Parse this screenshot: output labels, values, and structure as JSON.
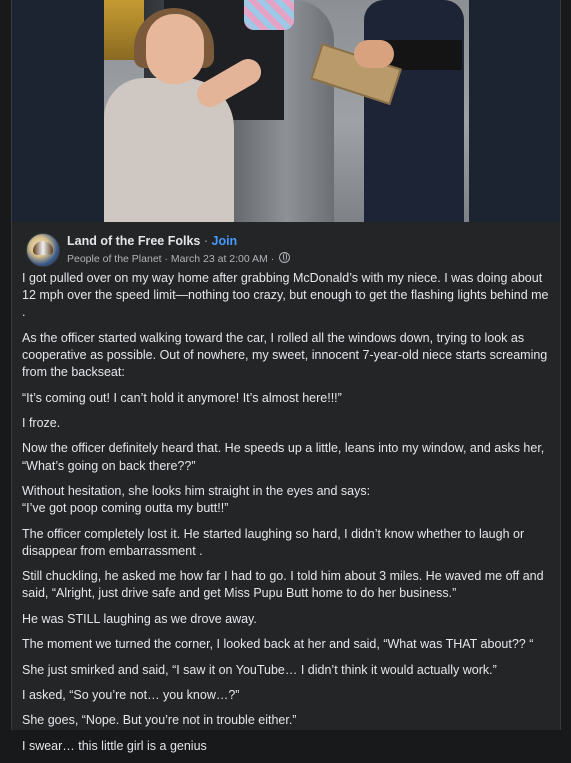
{
  "post": {
    "page_name": "Land of the Free Folks",
    "separator": "·",
    "join_label": "Join",
    "author": "People of the Planet",
    "timestamp": "March 23 at 2:00 AM",
    "privacy_icon": "globe-icon",
    "paragraphs": [
      "I got pulled over on my way home after grabbing McDonald’s with my niece. I was doing about 12 mph over the speed limit—nothing too crazy, but enough to get the flashing lights behind me .",
      "As the officer started walking toward the car, I rolled all the windows down, trying to look as cooperative as possible. Out of nowhere, my sweet, innocent 7-year-old niece starts screaming from the backseat:",
      "“It’s coming out! I can’t hold it anymore! It’s almost here!!!”",
      "I froze.",
      "Now the officer definitely heard that. He speeds up a little, leans into my window, and asks her, “What’s going on back there??”",
      "Without hesitation, she looks him straight in the eyes and says:\n“I’ve got poop coming outta my butt!!”",
      "The officer completely lost it. He started laughing so hard, I didn’t know whether to laugh or disappear from embarrassment .",
      "Still chuckling, he asked me how far I had to go. I told him about 3 miles. He waved me off and said, “Alright, just drive safe and get Miss Pupu Butt home to do her business.”",
      "He was STILL laughing as we drove away.",
      "The moment we turned the corner, I looked back at her and said, “What was THAT about?? “",
      "She just smirked and said, “I saw it on YouTube… I didn’t think it would actually work.”",
      "I asked, “So you’re not… you know…?”",
      "She goes, “Nope. But you’re not in trouble either.”",
      "I swear… this little girl is a genius"
    ]
  },
  "colors": {
    "background": "#18191a",
    "card": "#242526",
    "text": "#e4e6eb",
    "secondary_text": "#b0b3b8",
    "link": "#4599ff"
  }
}
